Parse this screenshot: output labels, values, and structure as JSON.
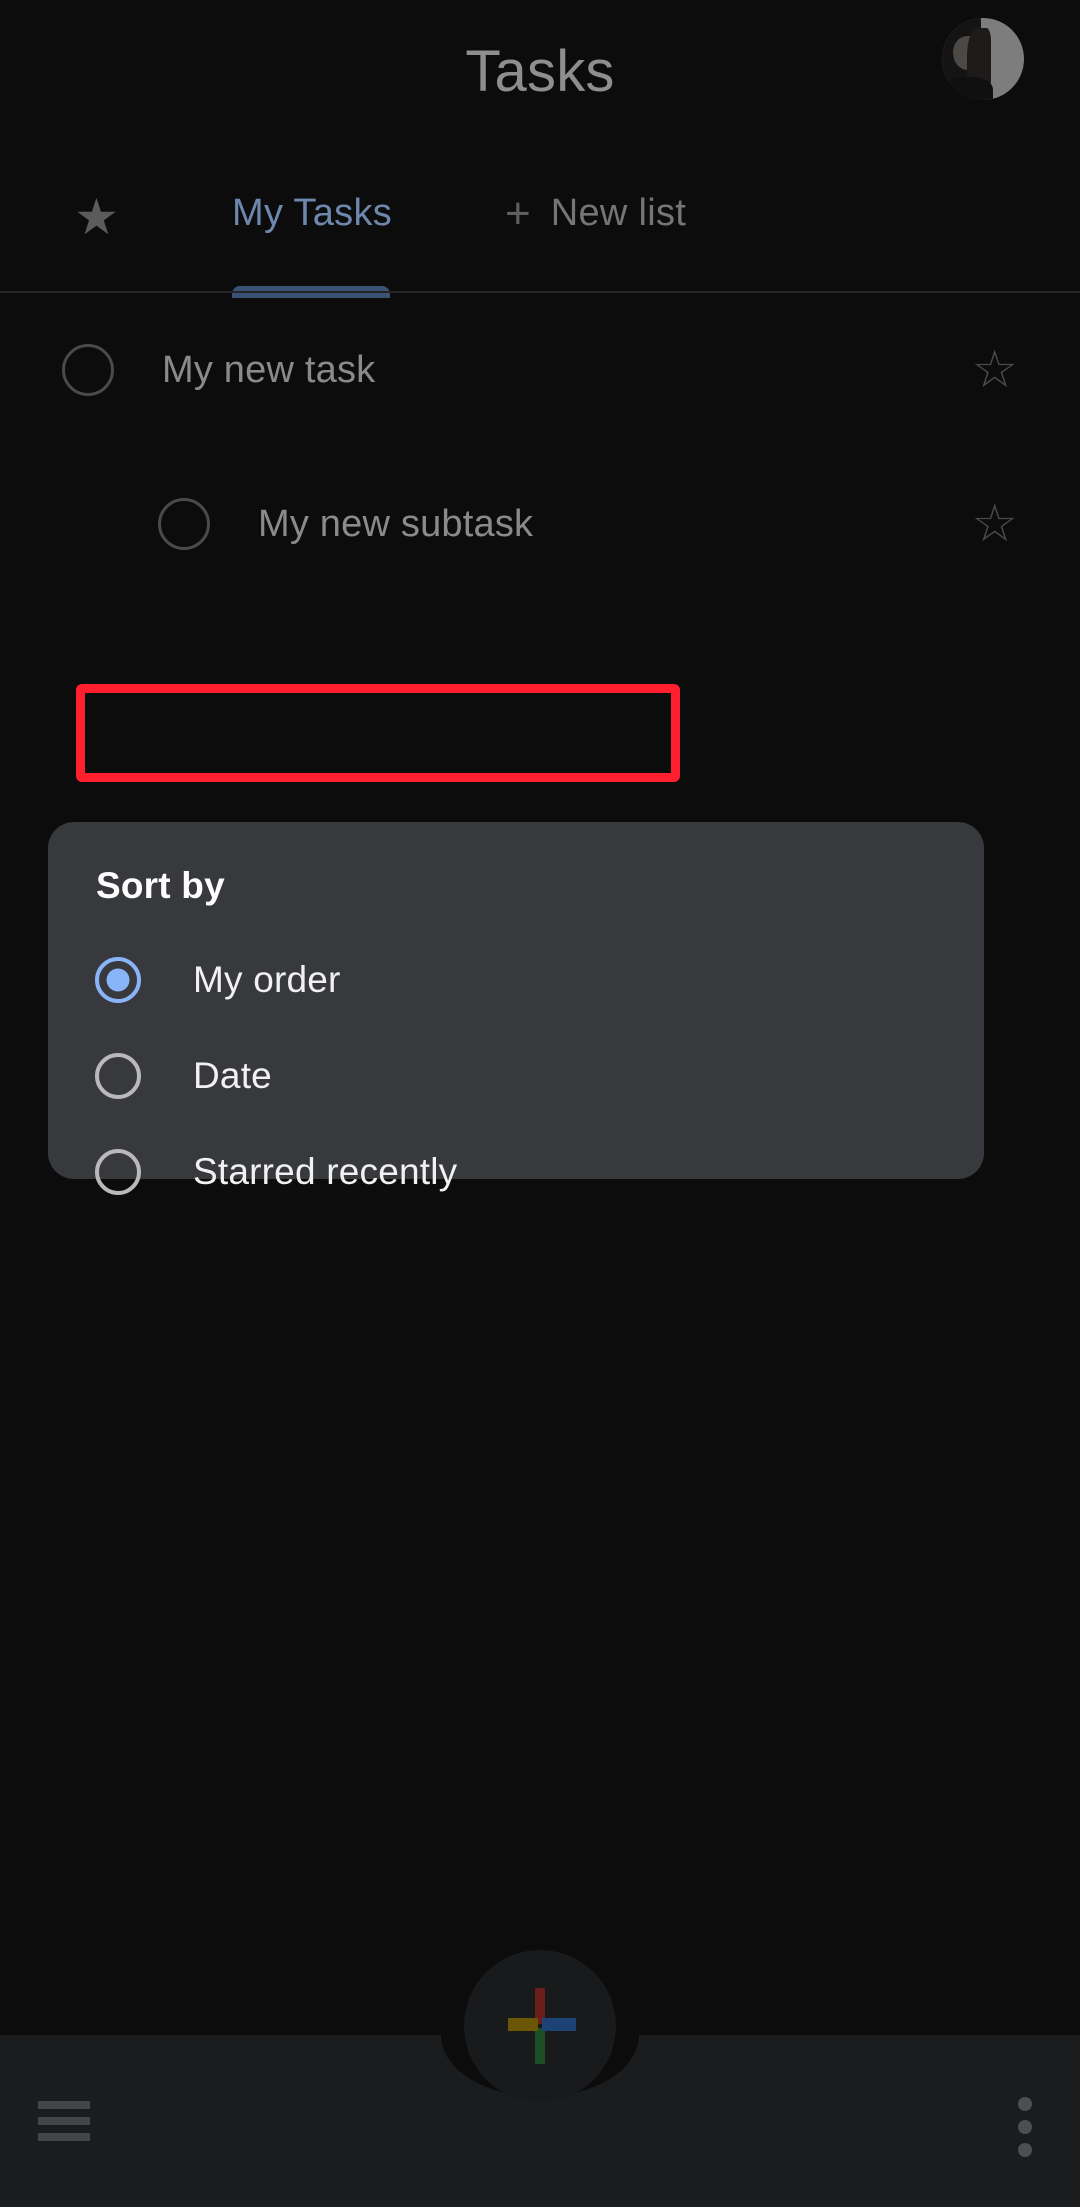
{
  "app": {
    "title": "Tasks",
    "avatar_name": "user-avatar"
  },
  "tabs": {
    "star_icon": "star-filled-icon",
    "my_tasks_label": "My Tasks",
    "new_list_plus": "+",
    "new_list_label": "New list"
  },
  "tasks": [
    {
      "title": "My new task",
      "sub": false,
      "checked": false,
      "starred": false
    },
    {
      "title": "My new subtask",
      "sub": true,
      "checked": false,
      "starred": false
    }
  ],
  "sort_dialog": {
    "title": "Sort by",
    "options": [
      {
        "label": "My order",
        "selected": true
      },
      {
        "label": "Date",
        "selected": false
      },
      {
        "label": "Starred recently",
        "selected": false
      }
    ]
  },
  "fab": {
    "icon": "plus-icon",
    "colors": {
      "top": "#6b1e1b",
      "bottom": "#1b4f28",
      "left": "#6b5605",
      "right": "#1d4276"
    }
  },
  "bottom_bar": {
    "menu_icon": "hamburger-menu-icon",
    "overflow_icon": "more-vertical-icon"
  },
  "colors": {
    "background": "#0c0c0d",
    "dialog": "#37393c",
    "accent_blue": "#8ab4f8",
    "tab_active": "#6d87ad",
    "highlight": "#ff1f2e"
  }
}
